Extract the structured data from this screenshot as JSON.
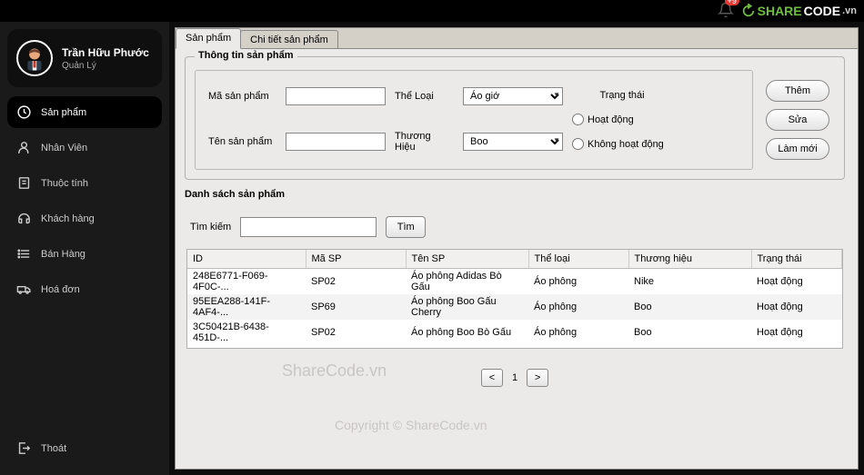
{
  "header": {
    "badge": "+9",
    "logo_share": "SHARE",
    "logo_code": "CODE",
    "logo_vn": ".vn"
  },
  "user": {
    "name": "Trần Hữu Phước",
    "role": "Quản Lý"
  },
  "menu": {
    "items": [
      {
        "label": "Sản phẩm"
      },
      {
        "label": "Nhân Viên"
      },
      {
        "label": "Thuộc tính"
      },
      {
        "label": "Khách hàng"
      },
      {
        "label": "Bán Hàng"
      },
      {
        "label": "Hoá đơn"
      }
    ],
    "exit": "Thoát"
  },
  "tabs": {
    "t1": "Sản phẩm",
    "t2": "Chi tiết sản phẩm"
  },
  "form": {
    "fieldset_title": "Thông tin sản phẩm",
    "labels": {
      "ma": "Mã sản phẩm",
      "ten": "Tên sản phẩm",
      "theloai": "Thể Loại",
      "thuonghieu": "Thương Hiệu",
      "trangthai": "Trạng thái"
    },
    "selects": {
      "theloai": "Áo giớ",
      "thuonghieu": "Boo"
    },
    "radios": {
      "hoatdong": "Hoạt động",
      "khong": "Không hoạt động"
    },
    "buttons": {
      "them": "Thêm",
      "sua": "Sửa",
      "lammoi": "Làm mới"
    }
  },
  "list": {
    "title": "Danh sách sản phẩm",
    "search_label": "Tìm kiếm",
    "search_btn": "Tìm",
    "headers": {
      "id": "ID",
      "ma": "Mã SP",
      "ten": "Tên SP",
      "tl": "Thể loại",
      "th": "Thương hiệu",
      "tt": "Trạng thái"
    },
    "rows": [
      {
        "id": "248E6771-F069-4F0C-...",
        "ma": "SP02",
        "ten": "Áo phông Adidas Bò Gấu",
        "tl": "Áo phông",
        "th": "Nike",
        "tt": "Hoạt động"
      },
      {
        "id": "95EEA288-141F-4AF4-...",
        "ma": "SP69",
        "ten": "Áo phông Boo Gấu Cherry",
        "tl": "Áo phông",
        "th": "Boo",
        "tt": "Hoạt động"
      },
      {
        "id": "3C50421B-6438-451D-...",
        "ma": "SP02",
        "ten": "Áo phông Boo Bò Gấu",
        "tl": "Áo phông",
        "th": "Boo",
        "tt": "Hoạt động"
      }
    ]
  },
  "paginator": {
    "prev": "<",
    "page": "1",
    "next": ">"
  },
  "watermarks": {
    "w1": "ShareCode.vn",
    "w2": "Copyright © ShareCode.vn"
  }
}
